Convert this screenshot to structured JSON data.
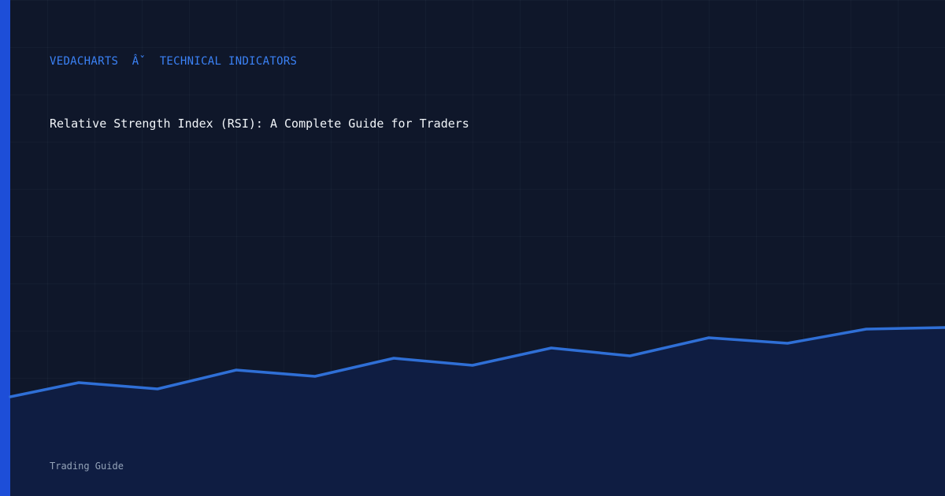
{
  "header": {
    "brand": "VEDACHARTS",
    "separator": "Âˇ",
    "category": "TECHNICAL INDICATORS"
  },
  "article": {
    "title": "Relative Strength Index (RSI): A Complete Guide for Traders"
  },
  "footer": {
    "label": "Trading Guide"
  },
  "colors": {
    "background": "#0f172a",
    "accent": "#1d4ed8",
    "breadcrumb": "#3b82f6",
    "line": "#2f6fd6",
    "area": "#0f1d42",
    "title": "#f1f5f9",
    "footer": "#94a3b8"
  }
}
